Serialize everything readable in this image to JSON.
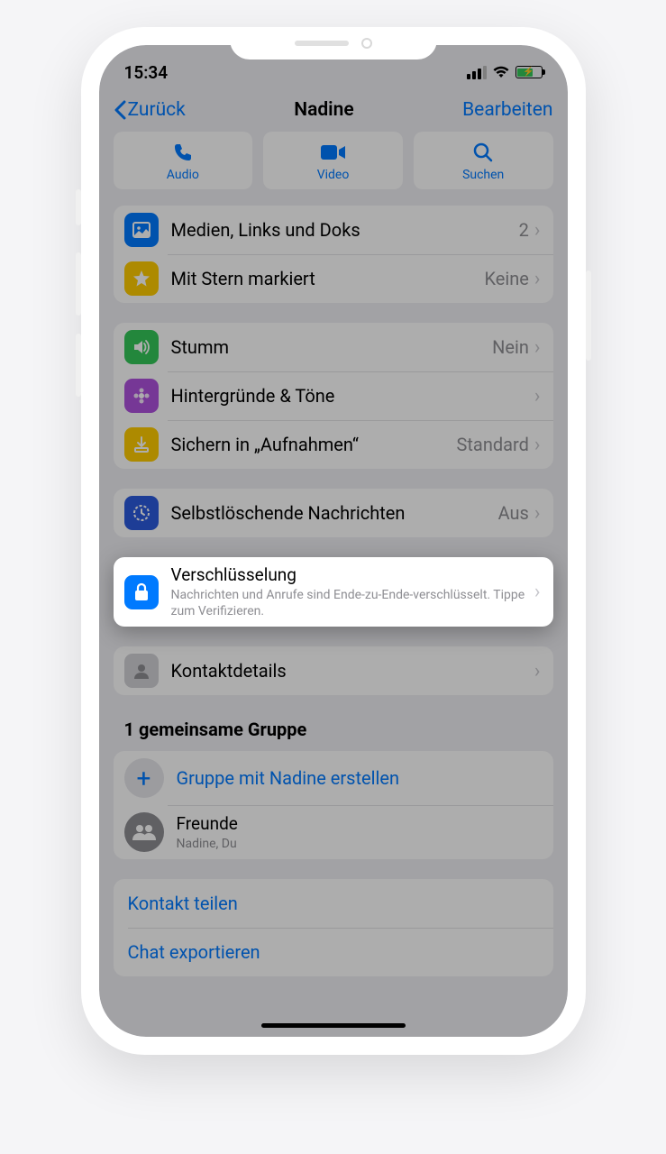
{
  "status": {
    "time": "15:34"
  },
  "nav": {
    "back": "Zurück",
    "title": "Nadine",
    "edit": "Bearbeiten"
  },
  "actions": {
    "audio": "Audio",
    "video": "Video",
    "search": "Suchen"
  },
  "section1": {
    "media": {
      "label": "Medien, Links und Doks",
      "value": "2"
    },
    "starred": {
      "label": "Mit Stern markiert",
      "value": "Keine"
    }
  },
  "section2": {
    "mute": {
      "label": "Stumm",
      "value": "Nein"
    },
    "wallpaper": {
      "label": "Hintergründe & Töne"
    },
    "save": {
      "label": "Sichern in „Aufnahmen“",
      "value": "Standard"
    }
  },
  "section3": {
    "disappearing": {
      "label": "Selbstlöschende Nachrichten",
      "value": "Aus"
    }
  },
  "encryption": {
    "label": "Verschlüsselung",
    "sub": "Nachrichten und Anrufe sind Ende-zu-Ende-verschlüsselt. Tippe zum Verifizieren."
  },
  "section4": {
    "contact": {
      "label": "Kontaktdetails"
    }
  },
  "groups": {
    "header": "1 gemeinsame Gruppe",
    "create": "Gruppe mit Nadine erstellen",
    "group1": {
      "name": "Freunde",
      "members": "Nadine, Du"
    }
  },
  "links": {
    "share": "Kontakt teilen",
    "export": "Chat exportieren"
  },
  "colors": {
    "blue": "#007aff",
    "green": "#34c759",
    "orange": "#ff9500",
    "purple": "#af52de",
    "gray": "#8e8e93"
  }
}
